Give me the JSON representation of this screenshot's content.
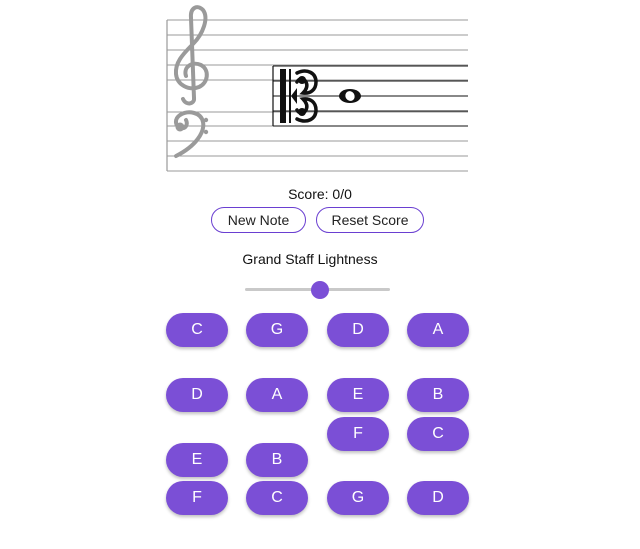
{
  "score": {
    "text": "Score: 0/0"
  },
  "buttons": {
    "new_note": "New Note",
    "reset_score": "Reset Score"
  },
  "slider": {
    "label": "Grand Staff Lightness",
    "value_fraction": 0.52
  },
  "staff": {
    "clefs": [
      "treble",
      "bass",
      "alto"
    ],
    "note": "whole-note"
  },
  "answers": [
    [
      "C",
      "G",
      "D",
      "A"
    ],
    [
      "D",
      "A",
      "E",
      "B"
    ],
    [
      "F",
      "C"
    ],
    [
      "E",
      "B"
    ],
    [
      "F",
      "C",
      "G",
      "D"
    ]
  ],
  "colors": {
    "accent": "#7b4fd6",
    "outline": "#6a3fd1",
    "staff_gray": "#9a9a9a"
  }
}
